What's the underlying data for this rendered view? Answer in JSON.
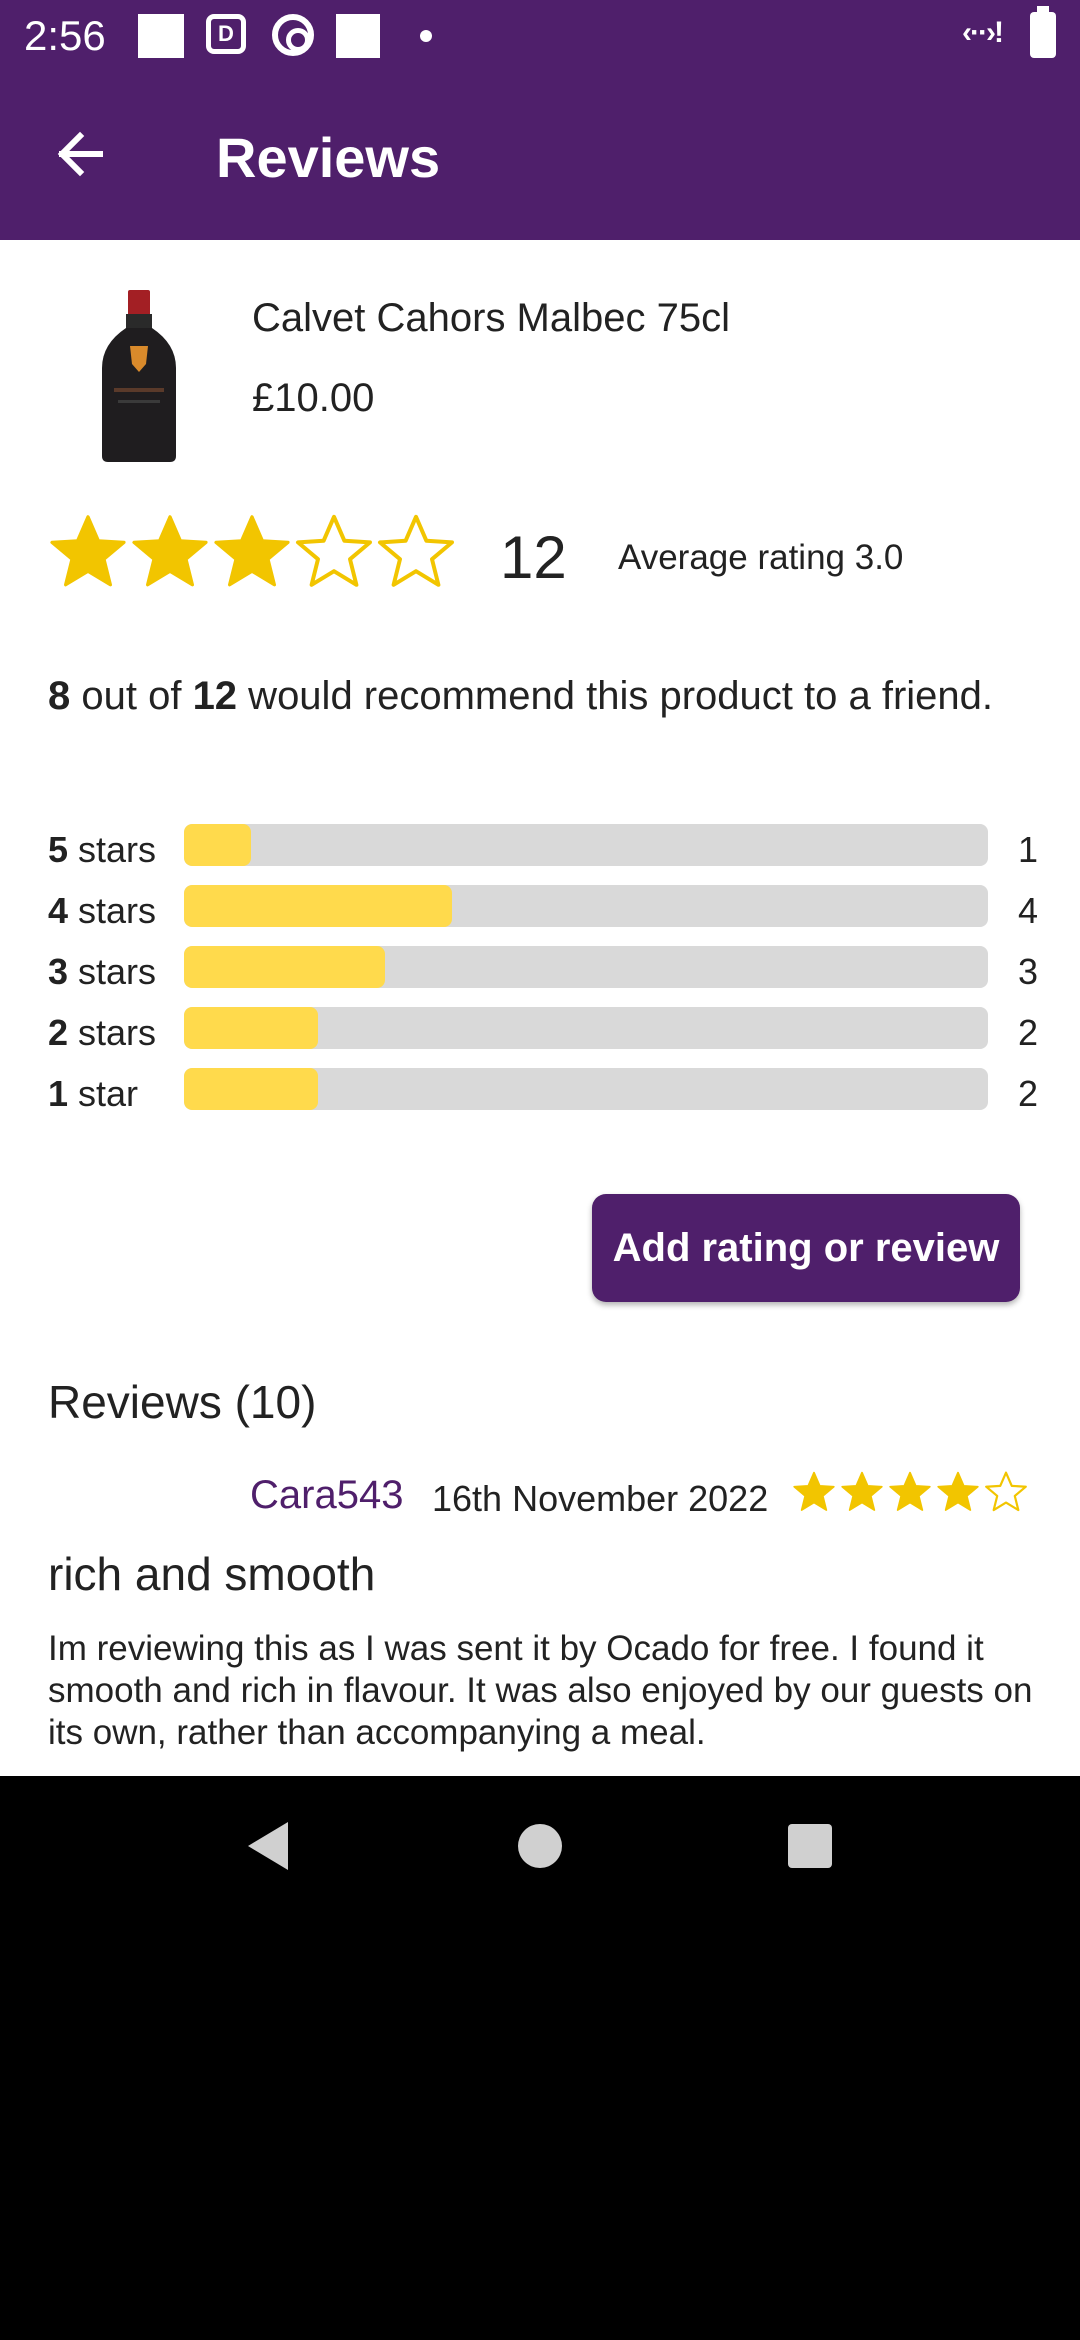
{
  "status_bar": {
    "time": "2:56",
    "icons": [
      "notification-square-icon",
      "d-app-icon",
      "target-icon",
      "notification-square-icon",
      "dot-icon",
      "network-icon",
      "battery-icon"
    ],
    "network_glyph": "‹··›!"
  },
  "app_bar": {
    "title": "Reviews",
    "back_icon": "arrow-back-icon"
  },
  "product": {
    "name": "Calvet Cahors Malbec 75cl",
    "price": "£10.00",
    "image_icon": "wine-bottle-icon"
  },
  "summary": {
    "stars_filled": 3,
    "stars_total": 5,
    "review_count": "12",
    "average_label": "Average rating 3.0"
  },
  "recommend": {
    "count": "8",
    "middle": " out of ",
    "total": "12",
    "rest": " would recommend this product to a friend."
  },
  "distribution": {
    "total": 12,
    "rows": [
      {
        "num": "5",
        "label": " stars",
        "count": 1,
        "count_text": "1"
      },
      {
        "num": "4",
        "label": " stars",
        "count": 4,
        "count_text": "4"
      },
      {
        "num": "3",
        "label": " stars",
        "count": 3,
        "count_text": "3"
      },
      {
        "num": "2",
        "label": " stars",
        "count": 2,
        "count_text": "2"
      },
      {
        "num": "1",
        "label": " star",
        "count": 2,
        "count_text": "2"
      }
    ]
  },
  "add_button": {
    "label": "Add rating or review"
  },
  "reviews": {
    "heading": "Reviews (10)",
    "items": [
      {
        "user": "Cara543",
        "date": "16th November 2022",
        "stars_filled": 4,
        "stars_total": 5,
        "title": "rich and smooth",
        "body": "Im reviewing this as I was sent it by Ocado for free. I found it smooth and rich in flavour. It was also enjoyed by our guests on its own, rather than accompanying a meal."
      }
    ]
  },
  "colors": {
    "brand_purple": "#4f1f6b",
    "star_yellow": "#f2c500",
    "bar_fill": "#ffda4c",
    "bar_track": "#d9d9d9"
  }
}
